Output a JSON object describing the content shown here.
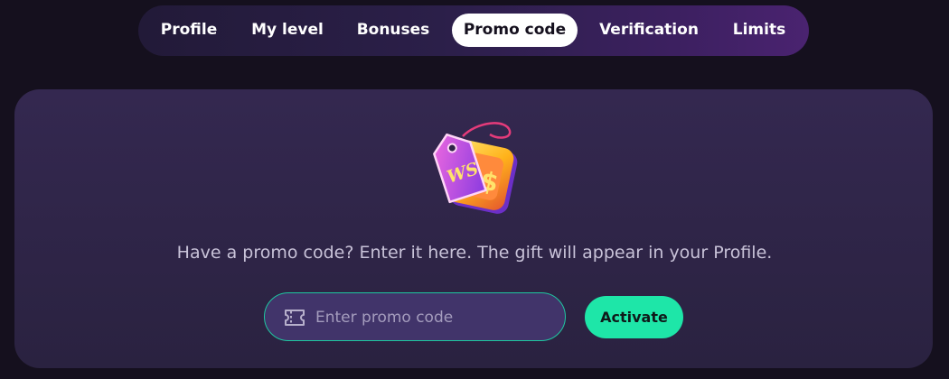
{
  "tabs": [
    {
      "label": "Profile",
      "active": false
    },
    {
      "label": "My level",
      "active": false
    },
    {
      "label": "Bonuses",
      "active": false
    },
    {
      "label": "Promo code",
      "active": true
    },
    {
      "label": "Verification",
      "active": false
    },
    {
      "label": "Limits",
      "active": false
    }
  ],
  "promo": {
    "illustration_text": "WS",
    "message": "Have a promo code? Enter it here. The gift will appear in your Profile.",
    "input_value": "",
    "input_placeholder": "Enter promo code",
    "activate_label": "Activate"
  },
  "colors": {
    "background": "#15101e",
    "panel": "#2e2447",
    "accent": "#1ee6a8",
    "input_border": "#1ec7a0"
  },
  "icons": [
    "promo-tag-icon",
    "ticket-icon"
  ]
}
